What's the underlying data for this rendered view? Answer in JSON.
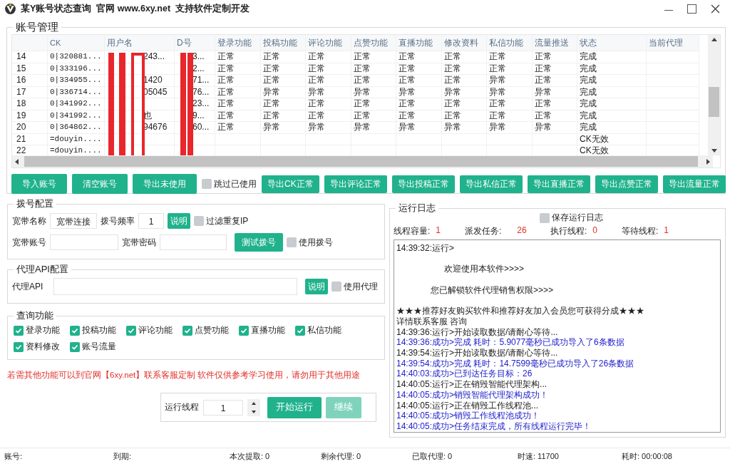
{
  "window": {
    "title": "某Y账号状态查询  官网 www.6xy.net  支持软件定制开发"
  },
  "account_group": {
    "title": "账号管理",
    "table": {
      "columns": [
        "CK",
        "用户名",
        "D号",
        "登录功能",
        "投稿功能",
        "评论功能",
        "点赞功能",
        "直播功能",
        "修改资料",
        "私信功能",
        "流量推送",
        "状态",
        "当前代理"
      ],
      "rows": [
        {
          "no": "14",
          "ck": "0|320881...",
          "user": "243...",
          "did": "3...",
          "funcs": [
            "正常",
            "正常",
            "正常",
            "正常",
            "正常",
            "正常",
            "正常",
            "正常"
          ],
          "status": "完成"
        },
        {
          "no": "15",
          "ck": "0|333196...",
          "user": "",
          "did": "2...",
          "funcs": [
            "正常",
            "正常",
            "正常",
            "正常",
            "正常",
            "正常",
            "正常",
            "正常"
          ],
          "status": "完成"
        },
        {
          "no": "16",
          "ck": "0|334955...",
          "user": "1420",
          "did": "71...",
          "funcs": [
            "正常",
            "正常",
            "正常",
            "正常",
            "正常",
            "正常",
            "异常",
            "正常"
          ],
          "status": "完成"
        },
        {
          "no": "17",
          "ck": "0|336714...",
          "user": "05045",
          "did": "76...",
          "funcs": [
            "正常",
            "异常",
            "异常",
            "异常",
            "异常",
            "异常",
            "异常",
            "异常"
          ],
          "status": "完成"
        },
        {
          "no": "18",
          "ck": "0|341992...",
          "user": "",
          "did": "23...",
          "funcs": [
            "正常",
            "正常",
            "正常",
            "正常",
            "正常",
            "正常",
            "正常",
            "正常"
          ],
          "status": "完成"
        },
        {
          "no": "19",
          "ck": "0|341992...",
          "user": "也",
          "did": "9...",
          "funcs": [
            "正常",
            "正常",
            "正常",
            "正常",
            "正常",
            "正常",
            "正常",
            "正常"
          ],
          "status": "完成"
        },
        {
          "no": "20",
          "ck": "0|364862...",
          "user": "94676",
          "did": "60...",
          "funcs": [
            "正常",
            "异常",
            "异常",
            "异常",
            "异常",
            "异常",
            "异常",
            "异常"
          ],
          "status": "完成"
        },
        {
          "no": "21",
          "ck": "=douyin....",
          "user": "",
          "did": "",
          "funcs": [],
          "status": "CK无效"
        },
        {
          "no": "22",
          "ck": "=douyin....",
          "user": "",
          "did": "",
          "funcs": [],
          "status": "CK无效"
        }
      ]
    },
    "actions": [
      {
        "kind": "button",
        "label": "导入账号"
      },
      {
        "kind": "button",
        "label": "清空账号"
      },
      {
        "kind": "button",
        "label": "导出未使用"
      },
      {
        "kind": "checkbox",
        "label": "跳过已使用",
        "checked": false
      },
      {
        "kind": "button",
        "label": "导出CK正常"
      },
      {
        "kind": "button",
        "label": "导出评论正常"
      },
      {
        "kind": "button",
        "label": "导出投稿正常"
      },
      {
        "kind": "button",
        "label": "导出私信正常"
      },
      {
        "kind": "button",
        "label": "导出直播正常"
      },
      {
        "kind": "button",
        "label": "导出点赞正常"
      },
      {
        "kind": "button",
        "label": "导出流量正常"
      }
    ]
  },
  "dial_group": {
    "title": "拨号配置",
    "name_label": "宽带名称",
    "name_value": "宽带连接",
    "freq_label": "拨号频率",
    "freq_value": "1",
    "help_button": "说明",
    "filter_ip": {
      "label": "过滤重复IP",
      "checked": false
    },
    "account_label": "宽带账号",
    "password_label": "宽带密码",
    "test_button": "测试拨号",
    "use_dial": {
      "label": "使用拨号",
      "checked": false
    }
  },
  "proxy_group": {
    "title": "代理API配置",
    "api_label": "代理API",
    "help_button": "说明",
    "use_proxy": {
      "label": "使用代理",
      "checked": false
    }
  },
  "query_group": {
    "title": "查询功能",
    "options": [
      {
        "label": "登录功能",
        "checked": true
      },
      {
        "label": "投稿功能",
        "checked": true
      },
      {
        "label": "评论功能",
        "checked": true
      },
      {
        "label": "点赞功能",
        "checked": true
      },
      {
        "label": "直播功能",
        "checked": true
      },
      {
        "label": "私信功能",
        "checked": true
      },
      {
        "label": "资料修改",
        "checked": true
      },
      {
        "label": "账号流量",
        "checked": true
      }
    ]
  },
  "notice": "若需其他功能可以到官网【6xy.net】联系客服定制 软件仅供参考学习使用，请勿用于其他用途",
  "run_box": {
    "threads_label": "运行线程",
    "threads_value": "1",
    "start_button": {
      "label": "开始运行",
      "disabled": false
    },
    "continue_button": {
      "label": "继续",
      "disabled": true
    }
  },
  "log_group": {
    "title": "运行日志",
    "save_log": {
      "label": "保存运行日志",
      "checked": false
    },
    "stats": [
      {
        "label": "线程容量:",
        "value": "1"
      },
      {
        "label": "派发任务:",
        "value": "26"
      },
      {
        "label": "执行线程:",
        "value": "0"
      },
      {
        "label": "等待线程:",
        "value": "1"
      }
    ],
    "lines": [
      {
        "kind": "info",
        "text": "14:39:32:运行>"
      },
      {
        "kind": "blank"
      },
      {
        "kind": "center",
        "text": "欢迎使用本软件>>>>"
      },
      {
        "kind": "blank"
      },
      {
        "kind": "indent",
        "text": "您已解锁软件代理销售权限>>>>"
      },
      {
        "kind": "blank"
      },
      {
        "kind": "info",
        "text": "★★★推荐好友购买软件和推荐好友加入会员您可获得分成★★★"
      },
      {
        "kind": "info",
        "text": "详情联系客服   咨询"
      },
      {
        "kind": "info",
        "text": "14:39:36:运行>开始读取数据/请耐心等待..."
      },
      {
        "kind": "success",
        "text": "14:39:36:成功>完成 耗时：5.9077毫秒已成功导入了6条数据"
      },
      {
        "kind": "info",
        "text": "14:39:54:运行>开始读取数据/请耐心等待..."
      },
      {
        "kind": "success",
        "text": "14:39:54:成功>完成 耗时：14.7599毫秒已成功导入了26条数据"
      },
      {
        "kind": "success",
        "text": "14:40:03:成功>已到达任务目标：26"
      },
      {
        "kind": "info",
        "text": "14:40:05:运行>正在销毁智能代理架构..."
      },
      {
        "kind": "success",
        "text": "14:40:05:成功>销毁智能代理架构成功！"
      },
      {
        "kind": "info",
        "text": "14:40:05:运行>正在销毁工作线程池..."
      },
      {
        "kind": "success",
        "text": "14:40:05:成功>销毁工作线程池成功！"
      },
      {
        "kind": "success",
        "text": "14:40:05:成功>任务结束完成，所有线程运行完毕！"
      }
    ]
  },
  "status_bar": [
    "账号:",
    "到期:",
    "本次提取: 0",
    "剩余代理: 0",
    "已取代理: 0",
    "时速: 11700",
    "耗时: 00:00:08"
  ]
}
